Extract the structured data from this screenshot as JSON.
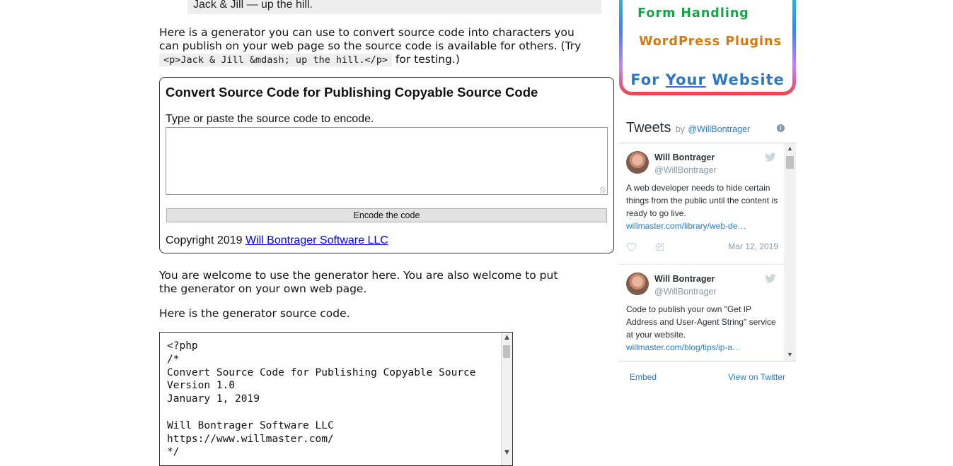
{
  "top_quote": "Jack & Jill — up the hill.",
  "intro": {
    "text": "Here is a generator you can use to convert source code into characters you can publish on your web page so the source code is available for others. (Try",
    "code": "<p>Jack & Jill &mdash; up the hill.</p>",
    "after": "for testing.)"
  },
  "converter": {
    "title": "Convert Source Code for Publishing Copyable Source Code",
    "label": "Type or paste the source code to encode.",
    "textarea_value": "",
    "button_label": "Encode the code",
    "copyright_prefix": "Copyright 2019",
    "copyright_link": "Will Bontrager Software LLC"
  },
  "welcome_text": "You are welcome to use the generator here. You are also welcome to put the generator on your own web page.",
  "source_intro": "Here is the generator source code.",
  "source_code": "<?php\n/*\nConvert Source Code for Publishing Copyable Source\nVersion 1.0\nJanuary 1, 2019\n\nWill Bontrager Software LLC\nhttps://www.willmaster.com/\n*/",
  "ad": {
    "line1": "Form Handling",
    "line2": "WordPress Plugins",
    "line3_pre": "For",
    "line3_your": "Your",
    "line3_post": "Website",
    "colors": {
      "form": "#16a34a",
      "wordpress": "#d97706",
      "website": "#2e78c2"
    }
  },
  "twitter": {
    "title": "Tweets",
    "by": "by",
    "handle": "@WillBontrager",
    "tweets": [
      {
        "name": "Will Bontrager",
        "user": "@WillBontrager",
        "text": "A web developer needs to hide certain things from the public until the content is ready to go live.",
        "link": "willmaster.com/library/web-de…",
        "date": "Mar 12, 2019"
      },
      {
        "name": "Will Bontrager",
        "user": "@WillBontrager",
        "text": "Code to publish your own \"Get IP Address and User-Agent String\" service at your website.",
        "link": "willmaster.com/blog/tips/ip-a…"
      }
    ],
    "embed_label": "Embed",
    "view_label": "View on Twitter"
  }
}
